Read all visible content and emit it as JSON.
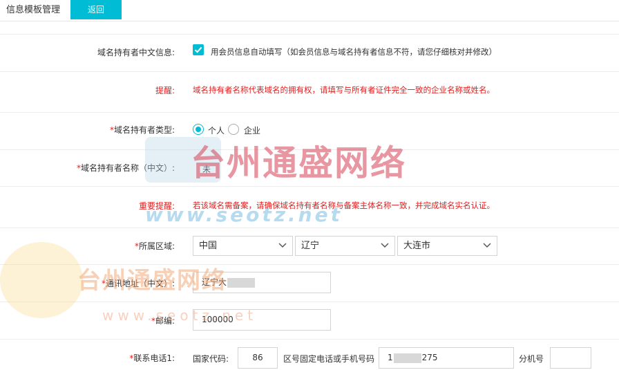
{
  "header": {
    "title": "信息模板管理",
    "back_label": "返回"
  },
  "rows": {
    "cn_info": {
      "label": "域名持有者中文信息:",
      "checkbox_checked": true,
      "checkbox_text": "用会员信息自动填写（如会员信息与域名持有者信息不符，请您仔细核对并修改）"
    },
    "tip": {
      "label": "提醒:",
      "text": "域名持有者名称代表域名的拥有权，请填写与所有者证件完全一致的企业名称或姓名。"
    },
    "owner_type": {
      "required": "*",
      "label": "域名持有者类型:",
      "options": [
        "个人",
        "企业"
      ],
      "selected": "个人"
    },
    "owner_name": {
      "required": "*",
      "label": "域名持有者名称（中文）:",
      "value": "未"
    },
    "important": {
      "label": "重要提醒:",
      "text": "若该域名需备案，请确保域名持有者名称与备案主体名称一致，并完成域名实名认证。"
    },
    "region": {
      "required": "*",
      "label": "所属区域:",
      "country": "中国",
      "province": "辽宁",
      "city": "大连市"
    },
    "address": {
      "required": "*",
      "label": "通讯地址（中文）:",
      "value_prefix": "辽宁大",
      "value_suffix": ""
    },
    "postcode": {
      "required": "*",
      "label": "邮编:",
      "value": "100000"
    },
    "phone": {
      "required": "*",
      "label": "联系电话1:",
      "country_code_label": "国家代码:",
      "country_code": "86",
      "number_label": "区号固定电话或手机号码",
      "number_prefix": "1",
      "number_suffix": "275",
      "ext_label": "分机号",
      "ext_value": ""
    }
  },
  "watermark": {
    "line1": "台州通盛网络",
    "line2": "www.seotz.net",
    "line3": "台州通盛网络",
    "line4": "www.seotz.net"
  },
  "colors": {
    "accent": "#00bcd4",
    "alert": "#e02020"
  }
}
